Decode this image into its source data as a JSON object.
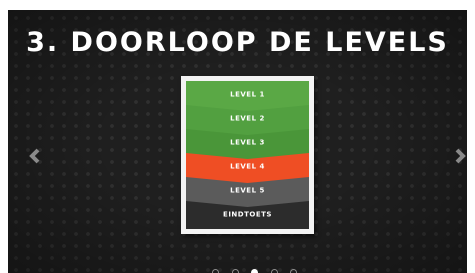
{
  "slide": {
    "title": "3. DOORLOOP DE LEVELS"
  },
  "levels": [
    {
      "label": "LEVEL 1",
      "color": "#5aa845"
    },
    {
      "label": "LEVEL 2",
      "color": "#52a040"
    },
    {
      "label": "LEVEL 3",
      "color": "#4a9639"
    },
    {
      "label": "LEVEL 4",
      "color": "#ef4e24"
    },
    {
      "label": "LEVEL 5",
      "color": "#5b5b5b"
    },
    {
      "label": "EINDTOETS",
      "color": "#2c2c2c"
    }
  ],
  "navigation": {
    "prev_icon": "chevron-left-icon",
    "next_icon": "chevron-right-icon",
    "dot_count": 5,
    "active_dot": 3
  },
  "colors": {
    "background": "#1f1f1f",
    "title": "#ffffff",
    "card": "#f3f3f3"
  }
}
